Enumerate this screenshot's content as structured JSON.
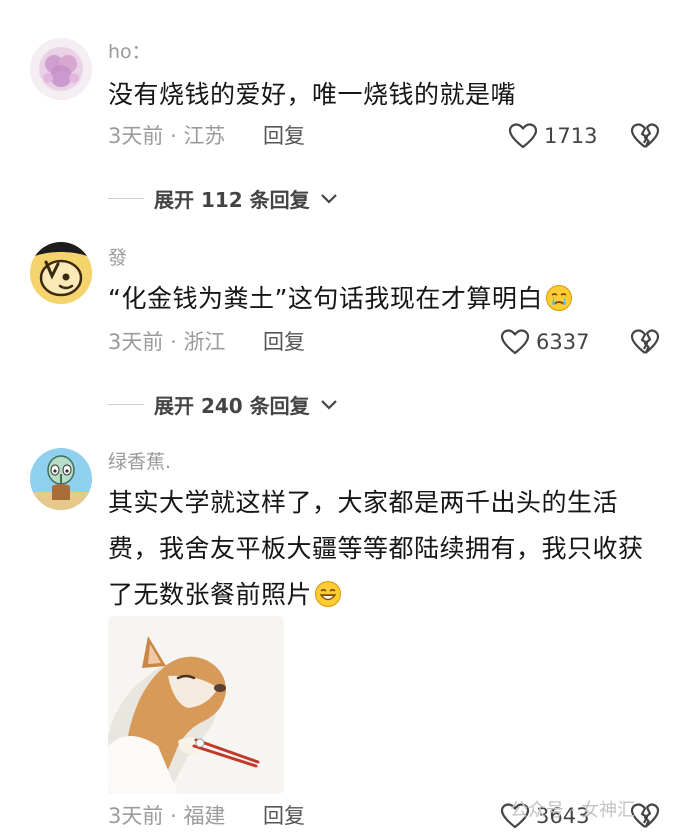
{
  "comments": [
    {
      "username": "ho：",
      "text": "没有烧钱的爱好，唯一烧钱的就是嘴",
      "time": "3天前",
      "location": "江苏",
      "reply_label": "回复",
      "likes": "1713",
      "expand_label": "展开 112 条回复"
    },
    {
      "username": "發",
      "text": "“化金钱为粪土”这句话我现在才算明白",
      "time": "3天前",
      "location": "浙江",
      "reply_label": "回复",
      "likes": "6337",
      "expand_label": "展开 240 条回复"
    },
    {
      "username": "绿香蕉.",
      "text_lines": [
        "其实大学就这样了，大家都是两千出头的生活",
        "费，我舍友平板大疆等等都陆续拥有，我只收获",
        "了无数张餐前照片"
      ],
      "time": "3天前",
      "location": "福建",
      "reply_label": "回复",
      "likes": "3643"
    }
  ],
  "watermark": "公众号 · 女神汇",
  "meta_separator": "·",
  "icons": [
    "heart-icon",
    "broken-heart-icon",
    "chevron-down-icon",
    "crying-emoji-icon",
    "grinning-emoji-icon",
    "cat-chopsticks-sticker"
  ],
  "colors": {
    "text": "#161616",
    "meta": "#9b9b9b",
    "username": "#9a9a9a",
    "expand": "#444444"
  }
}
